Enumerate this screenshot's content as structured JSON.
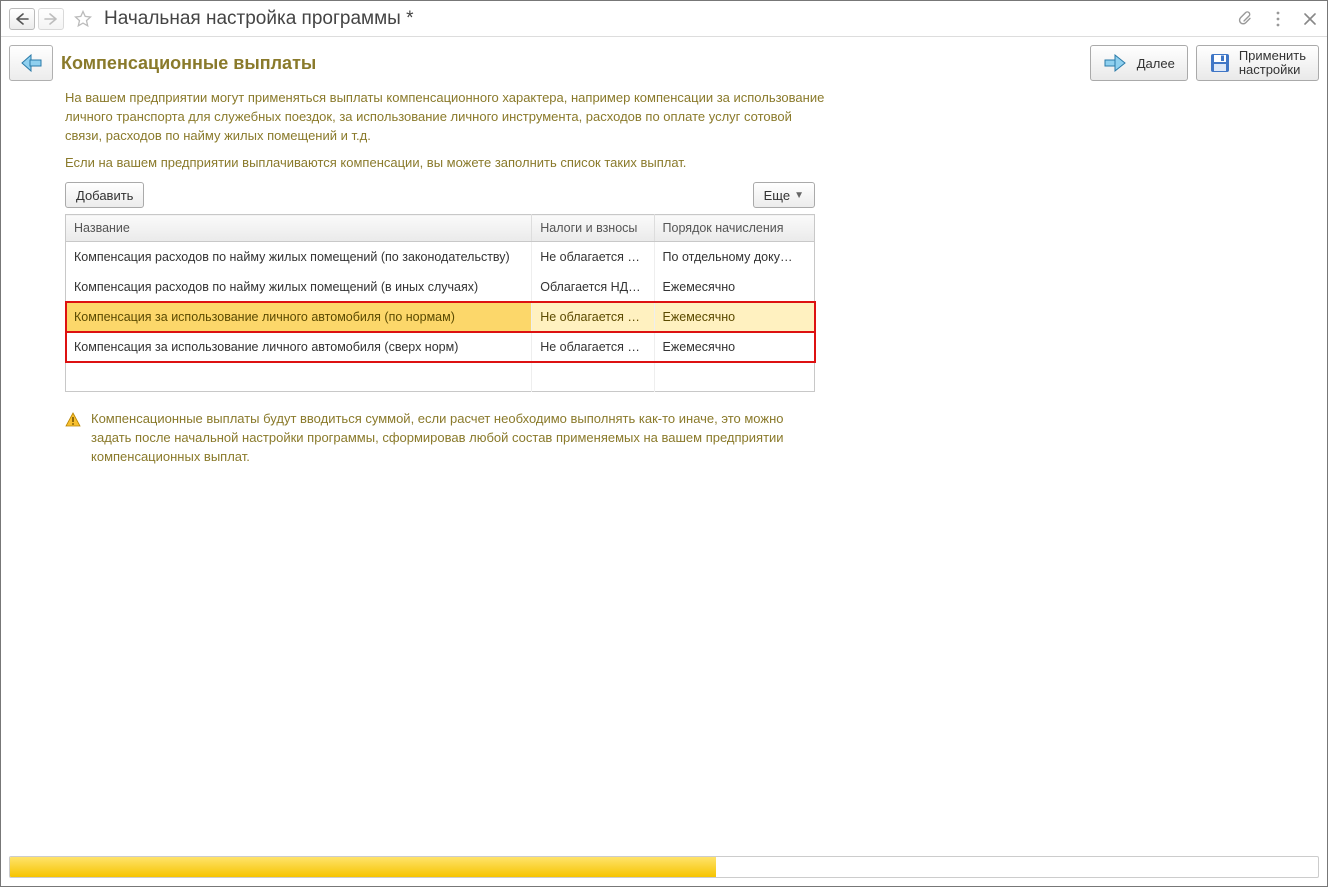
{
  "topbar": {
    "title": "Начальная настройка программы *"
  },
  "panel": {
    "title": "Компенсационные выплаты",
    "next_label": "Далее",
    "apply_line1": "Применить",
    "apply_line2": "настройки"
  },
  "intro": {
    "p1": "На вашем предприятии могут применяться выплаты компенсационного характера, например компенсации за использование личного транспорта для служебных поездок, за использование личного инструмента, расходов по оплате услуг сотовой связи, расходов по найму жилых помещений и т.д.",
    "p2": "Если на вашем предприятии выплачиваются компенсации, вы можете заполнить список таких выплат."
  },
  "toolbar": {
    "add_label": "Добавить",
    "more_label": "Еще"
  },
  "grid": {
    "headers": {
      "name": "Название",
      "tax": "Налоги и взносы",
      "order": "Порядок начисления"
    },
    "rows": [
      {
        "name": "Компенсация расходов по найму жилых помещений (по законодательству)",
        "tax": "Не облагается …",
        "order": "По отдельному доку…"
      },
      {
        "name": "Компенсация расходов по найму жилых помещений (в иных случаях)",
        "tax": "Облагается НД…",
        "order": "Ежемесячно"
      },
      {
        "name": "Компенсация за использование личного автомобиля (по нормам)",
        "tax": "Не облагается …",
        "order": "Ежемесячно"
      },
      {
        "name": "Компенсация за использование личного автомобиля (сверх норм)",
        "tax": "Не облагается …",
        "order": "Ежемесячно"
      }
    ]
  },
  "warning": {
    "text": "Компенсационные выплаты будут вводиться суммой, если расчет необходимо выполнять как-то иначе, это можно задать после начальной настройки программы, сформировав любой состав применяемых на вашем предприятии компенсационных выплат."
  },
  "progress": {
    "percent": 54
  }
}
